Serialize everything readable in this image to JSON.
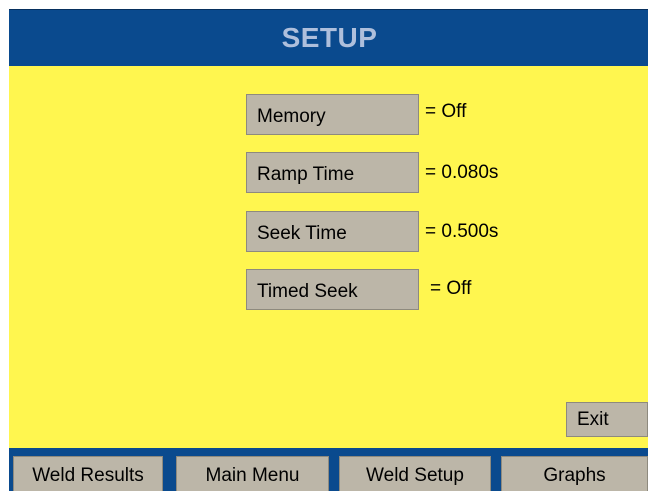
{
  "header": {
    "title": "SETUP"
  },
  "params": [
    {
      "label": "Memory",
      "value": "= Off"
    },
    {
      "label": "Ramp Time",
      "value": "= 0.080s"
    },
    {
      "label": "Seek Time",
      "value": "= 0.500s"
    },
    {
      "label": "Timed Seek",
      "value": "= Off"
    }
  ],
  "exit_label": "Exit",
  "tabs": [
    {
      "label": "Weld Results"
    },
    {
      "label": "Main Menu"
    },
    {
      "label": "Weld Setup"
    },
    {
      "label": "Graphs"
    }
  ],
  "colors": {
    "background": "#fff64f",
    "header": "#0a4a8e",
    "header_text": "#aebfdc",
    "button": "#bcb6a8"
  }
}
